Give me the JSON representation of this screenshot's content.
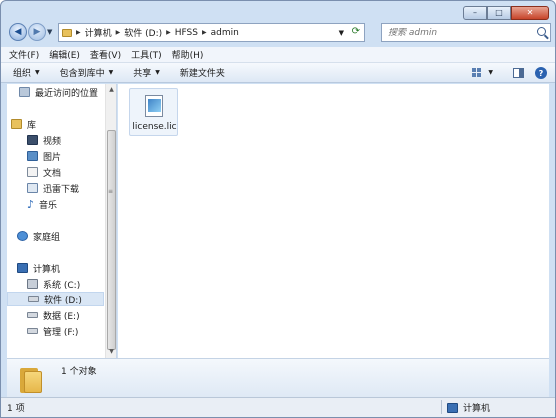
{
  "window": {
    "min_glyph": "–",
    "max_glyph": "□",
    "close_glyph": "✕"
  },
  "address": {
    "crumbs": [
      "计算机",
      "软件 (D:)",
      "HFSS",
      "admin"
    ]
  },
  "search": {
    "placeholder": "搜索 admin"
  },
  "menu": [
    "文件(F)",
    "编辑(E)",
    "查看(V)",
    "工具(T)",
    "帮助(H)"
  ],
  "command_bar": {
    "organize": "组织",
    "include_library": "包含到库中",
    "share": "共享",
    "new_folder": "新建文件夹"
  },
  "nav": {
    "recent": "最近访问的位置",
    "library": "库",
    "videos": "视频",
    "pictures": "图片",
    "documents": "文档",
    "thunder": "迅雷下载",
    "music": "音乐",
    "homegroup": "家庭组",
    "computer": "计算机",
    "drive_c": "系统 (C:)",
    "drive_d": "软件 (D:)",
    "drive_e": "数据 (E:)",
    "drive_f": "管理 (F:)"
  },
  "files": [
    {
      "name": "license.lic",
      "icon": "license-file-icon"
    }
  ],
  "details": {
    "summary": "1 个对象"
  },
  "status": {
    "count": "1 项",
    "location": "计算机"
  },
  "colors": {
    "frame": "#cfe0f3",
    "command_bar": "#dde8f5",
    "selection": "#d9e6f5",
    "close": "#c7442a"
  }
}
